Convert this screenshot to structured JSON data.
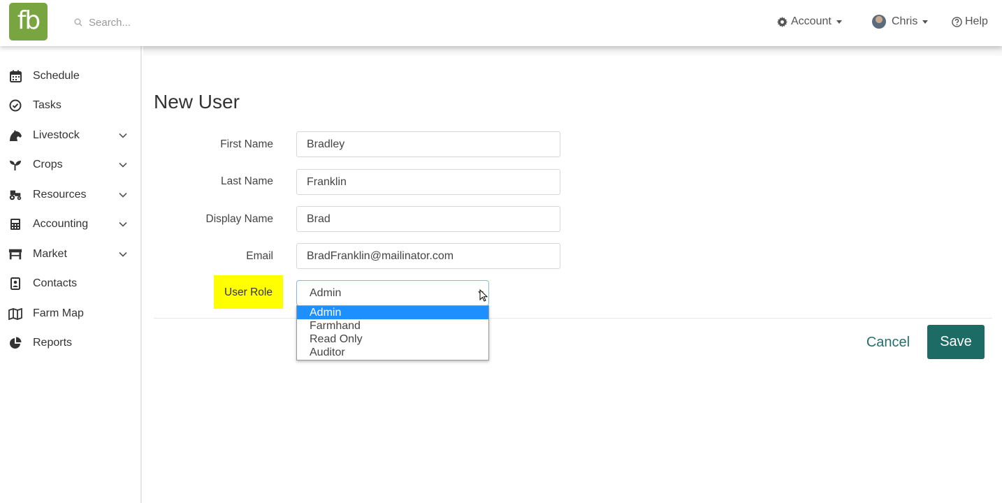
{
  "logo": {
    "text": "fb",
    "color": "#79a540"
  },
  "search": {
    "placeholder": "Search..."
  },
  "topnav": {
    "account_label": "Account",
    "user_label": "Chris",
    "help_label": "Help"
  },
  "sidebar": {
    "items": [
      {
        "label": "Schedule",
        "icon": "calendar-icon",
        "expandable": false
      },
      {
        "label": "Tasks",
        "icon": "check-circle-icon",
        "expandable": false
      },
      {
        "label": "Livestock",
        "icon": "horse-icon",
        "expandable": true
      },
      {
        "label": "Crops",
        "icon": "seedling-icon",
        "expandable": true
      },
      {
        "label": "Resources",
        "icon": "tractor-icon",
        "expandable": true
      },
      {
        "label": "Accounting",
        "icon": "calculator-icon",
        "expandable": true
      },
      {
        "label": "Market",
        "icon": "store-icon",
        "expandable": true
      },
      {
        "label": "Contacts",
        "icon": "address-book-icon",
        "expandable": false
      },
      {
        "label": "Farm Map",
        "icon": "map-icon",
        "expandable": false
      },
      {
        "label": "Reports",
        "icon": "pie-chart-icon",
        "expandable": false
      }
    ]
  },
  "page": {
    "title": "New User"
  },
  "form": {
    "first_name": {
      "label": "First Name",
      "value": "Bradley"
    },
    "last_name": {
      "label": "Last Name",
      "value": "Franklin"
    },
    "display_name": {
      "label": "Display Name",
      "value": "Brad"
    },
    "email": {
      "label": "Email",
      "value": "BradFranklin@mailinator.com"
    },
    "user_role": {
      "label": "User Role",
      "selected": "Admin",
      "options": [
        "Admin",
        "Farmhand",
        "Read Only",
        "Auditor"
      ],
      "highlight_color": "#ffff00"
    }
  },
  "actions": {
    "cancel_label": "Cancel",
    "save_label": "Save",
    "save_color": "#1d6b65"
  }
}
